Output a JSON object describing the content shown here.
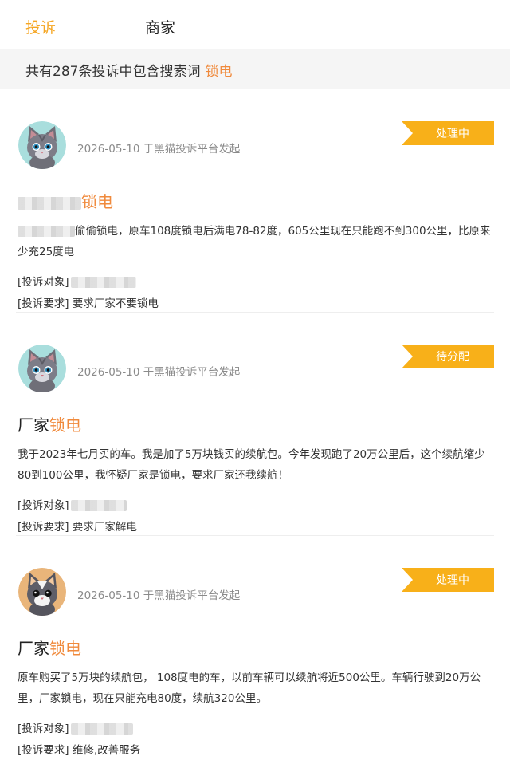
{
  "tabs": {
    "complaint_label": "投诉",
    "merchant_label": "商家"
  },
  "summary": {
    "text": "共有287条投诉中包含搜索词",
    "keyword": "锁电"
  },
  "colors": {
    "accent": "#f5a623",
    "highlight": "#f08a3c",
    "badge": "#f8b019"
  },
  "complaints": [
    {
      "avatar_icon": "gray-cat-avatar-icon",
      "meta": "2026-05-10 于黑猫投诉平台发起",
      "status": "处理中",
      "title_prefix": "",
      "title_keyword": "锁电",
      "body": "偷偷锁电，原车108度锁电后满电78-82度，605公里现在只能跑不到300公里，比原来少充25度电",
      "target_label": "[投诉对象]",
      "target_value": "",
      "request_label": "[投诉要求]",
      "request_value": "要求厂家不要锁电"
    },
    {
      "avatar_icon": "gray-cat-avatar-icon",
      "meta": "2026-05-10 于黑猫投诉平台发起",
      "status": "待分配",
      "title_prefix": "厂家",
      "title_keyword": "锁电",
      "body": "我于2023年七月买的车。我是加了5万块钱买的续航包。今年发现跑了20万公里后，这个续航缩少80到100公里，我怀疑厂家是锁电，要求厂家还我续航！",
      "target_label": "[投诉对象]",
      "target_value": "",
      "request_label": "[投诉要求]",
      "request_value": "要求厂家解电"
    },
    {
      "avatar_icon": "tan-cat-avatar-icon",
      "meta": "2026-05-10 于黑猫投诉平台发起",
      "status": "处理中",
      "title_prefix": "厂家",
      "title_keyword": "锁电",
      "body": "原车购买了5万块的续航包， 108度电的车，以前车辆可以续航将近500公里。车辆行驶到20万公里，厂家锁电，现在只能充电80度，续航320公里。",
      "target_label": "[投诉对象]",
      "target_value": "",
      "request_label": "[投诉要求]",
      "request_value": "维修,改善服务"
    }
  ]
}
